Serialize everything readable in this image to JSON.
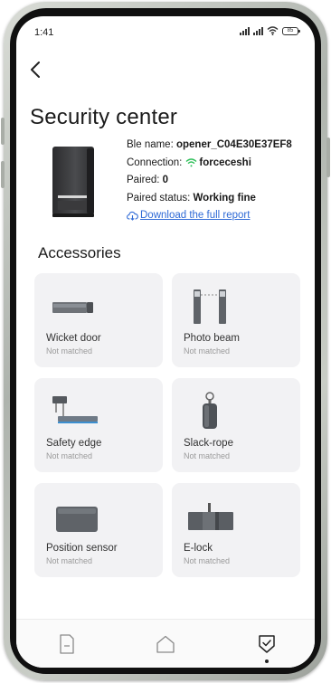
{
  "status_bar": {
    "time": "1:41",
    "battery": "85"
  },
  "header": {
    "back_icon": "chevron-left-icon",
    "title": "Security center"
  },
  "device": {
    "ble_name_label": "Ble name:",
    "ble_name": "opener_C04E30E37EF8",
    "connection_label": "Connection:",
    "connection": "forceceshi",
    "paired_label": "Paired:",
    "paired": "0",
    "paired_status_label": "Paired status:",
    "paired_status": "Working fine",
    "report_link": "Download the full report",
    "link_color": "#2f6ad6",
    "wifi_color": "#2fbf5a"
  },
  "accessories": {
    "title": "Accessories",
    "items": [
      {
        "name": "Wicket door",
        "status": "Not matched",
        "icon": "wicket-door-icon"
      },
      {
        "name": "Photo beam",
        "status": "Not matched",
        "icon": "photo-beam-icon"
      },
      {
        "name": "Safety edge",
        "status": "Not matched",
        "icon": "safety-edge-icon"
      },
      {
        "name": "Slack-rope",
        "status": "Not matched",
        "icon": "slack-rope-icon"
      },
      {
        "name": "Position sensor",
        "status": "Not matched",
        "icon": "position-sensor-icon"
      },
      {
        "name": "E-lock",
        "status": "Not matched",
        "icon": "e-lock-icon"
      }
    ]
  },
  "bottom_nav": {
    "items": [
      {
        "icon": "document-icon",
        "active": false
      },
      {
        "icon": "home-icon",
        "active": false
      },
      {
        "icon": "shield-check-icon",
        "active": true
      }
    ]
  }
}
